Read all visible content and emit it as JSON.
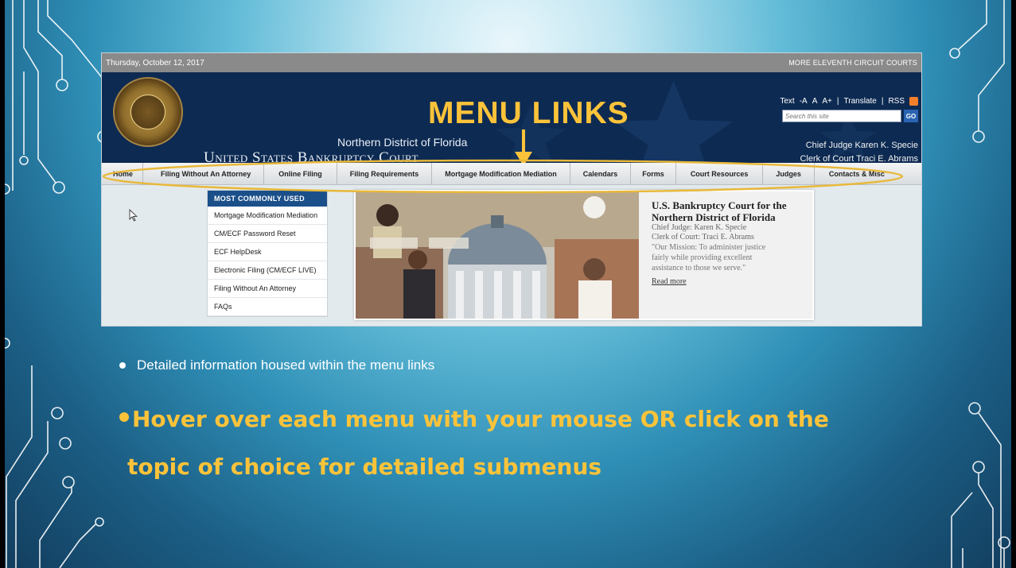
{
  "site": {
    "date": "Thursday, October 12, 2017",
    "top_right_link": "MORE ELEVENTH CIRCUIT COURTS",
    "heading_overlay": "MENU LINKS",
    "court_sub": "Northern District of Florida",
    "court_name": "United States Bankruptcy Court",
    "tools": {
      "text_label": "Text",
      "minus": "-A",
      "normal": "A",
      "plus": "A+",
      "sep1": "|",
      "translate": "Translate",
      "sep2": "|",
      "rss": "RSS"
    },
    "search": {
      "placeholder": "Search this site",
      "go_label": "GO"
    },
    "chief_judge": "Chief Judge Karen K. Specie",
    "clerk": "Clerk of Court Traci E. Abrams",
    "nav": [
      "Home",
      "Filing Without An Attorney",
      "Online Filing",
      "Filing Requirements",
      "Mortgage Modification Mediation",
      "Calendars",
      "Forms",
      "Court Resources",
      "Judges",
      "Contacts & Misc"
    ],
    "most_common": {
      "header": "MOST COMMONLY USED",
      "links": [
        "Mortgage Modification Mediation",
        "CM/ECF Password Reset",
        "ECF HelpDesk",
        "Electronic Filing (CM/ECF LIVE)",
        "Filing Without An Attorney",
        "FAQs"
      ]
    },
    "feature": {
      "title_line1": "U.S. Bankruptcy Court for the",
      "title_line2": "Northern District of Florida",
      "judge": "Chief Judge: Karen K. Specie",
      "clerk": "Clerk of Court: Traci E. Abrams",
      "mission_l1": "\"Our Mission: To administer justice",
      "mission_l2": "fairly while providing excellent",
      "mission_l3": "assistance to those we serve.\"",
      "read_more": "Read more"
    }
  },
  "slide": {
    "bullet1": "Detailed information housed within the menu links",
    "bullet2_line1": "Hover over each menu with your mouse OR click on the",
    "bullet2_line2": "topic of choice for detailed submenus"
  },
  "colors": {
    "accent_yellow": "#fcc33a",
    "banner_navy": "#0d2a52",
    "link_blue": "#1b4f8a"
  }
}
